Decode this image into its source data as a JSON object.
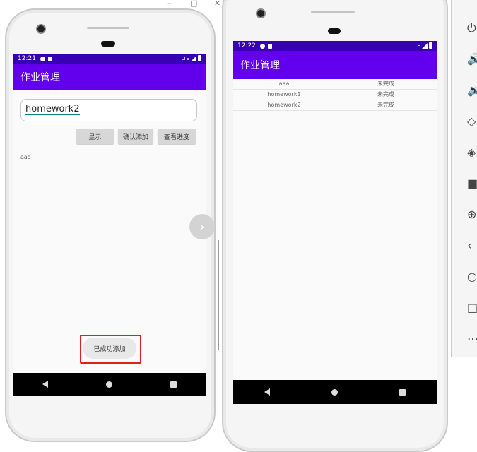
{
  "window": {
    "minimize_glyph": "–",
    "maximize_glyph": "□",
    "close_glyph": "✕"
  },
  "left_phone": {
    "status_time": "12:21",
    "status_network": "LTE",
    "app_title": "作业管理",
    "input_value": "homework2",
    "buttons": [
      "显示",
      "确认添加",
      "查看进度"
    ],
    "task_text": "aaa",
    "toast": "已成功添加"
  },
  "right_phone": {
    "status_time": "12:22",
    "status_network": "LTE",
    "app_title": "作业管理",
    "rows": [
      {
        "name": "aaa",
        "status": "未完成"
      },
      {
        "name": "homework1",
        "status": "未完成"
      },
      {
        "name": "homework2",
        "status": "未完成"
      }
    ]
  },
  "swipe_arrow": "›",
  "side_toolbar": [
    "⏻",
    "🔊",
    "🔉",
    "◇",
    "◈",
    "■",
    "⊕",
    "‹",
    "○",
    "□",
    "⋯"
  ],
  "colors": {
    "statusbar": "#3700b3",
    "appbar": "#6200ee",
    "highlight": "#e02020"
  }
}
